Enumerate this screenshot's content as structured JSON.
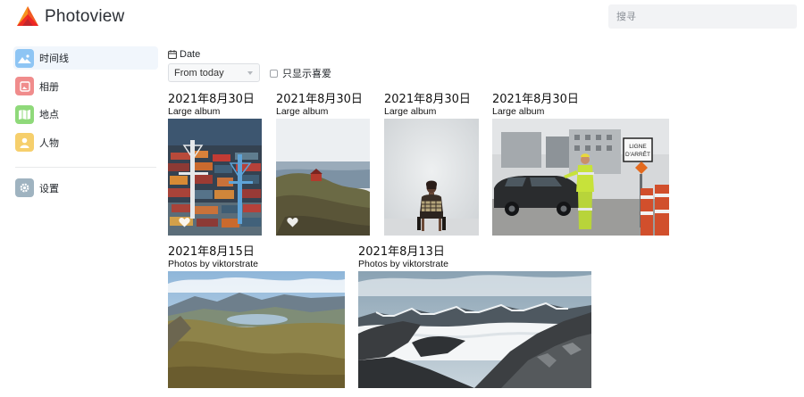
{
  "app": {
    "name": "Photoview"
  },
  "search": {
    "placeholder": "搜寻"
  },
  "sidebar": {
    "items": [
      {
        "label": "时间线",
        "icon": "timeline-icon",
        "color": "#8ec5f4",
        "active": true
      },
      {
        "label": "相册",
        "icon": "albums-icon",
        "color": "#f08c8c"
      },
      {
        "label": "地点",
        "icon": "places-icon",
        "color": "#8fd97a"
      },
      {
        "label": "人物",
        "icon": "people-icon",
        "color": "#f6cf6c"
      }
    ],
    "settings": {
      "label": "设置",
      "icon": "settings-icon",
      "color": "#9fb3c0"
    }
  },
  "filters": {
    "date_label": "Date",
    "date_value": "From today",
    "favorites_label": "只显示喜爱",
    "favorites_checked": false
  },
  "groups": [
    {
      "date": "2021年8月30日",
      "title": "Large album",
      "media": [
        {
          "subject": "container-port",
          "favorite": true
        }
      ]
    },
    {
      "date": "2021年8月30日",
      "title": "Large album",
      "media": [
        {
          "subject": "red-cabin-hillside",
          "favorite": true
        }
      ]
    },
    {
      "date": "2021年8月30日",
      "title": "Large album",
      "media": [
        {
          "subject": "woman-seated-portrait",
          "favorite": false
        }
      ]
    },
    {
      "date": "2021年8月30日",
      "title": "Large album",
      "media": [
        {
          "subject": "road-worker-street",
          "favorite": false,
          "sign_text": "LIGNE D'ARRÊT"
        }
      ]
    },
    {
      "date": "2021年8月15日",
      "title": "Photos by viktorstrate",
      "media": [
        {
          "subject": "mountain-valley-lake",
          "favorite": false
        }
      ]
    },
    {
      "date": "2021年8月13日",
      "title": "Photos by viktorstrate",
      "media": [
        {
          "subject": "mountain-cloud-inversion",
          "favorite": false
        }
      ]
    }
  ],
  "colors": {
    "accent": "#f05a22",
    "active_nav_bg": "#f1f6fc"
  }
}
